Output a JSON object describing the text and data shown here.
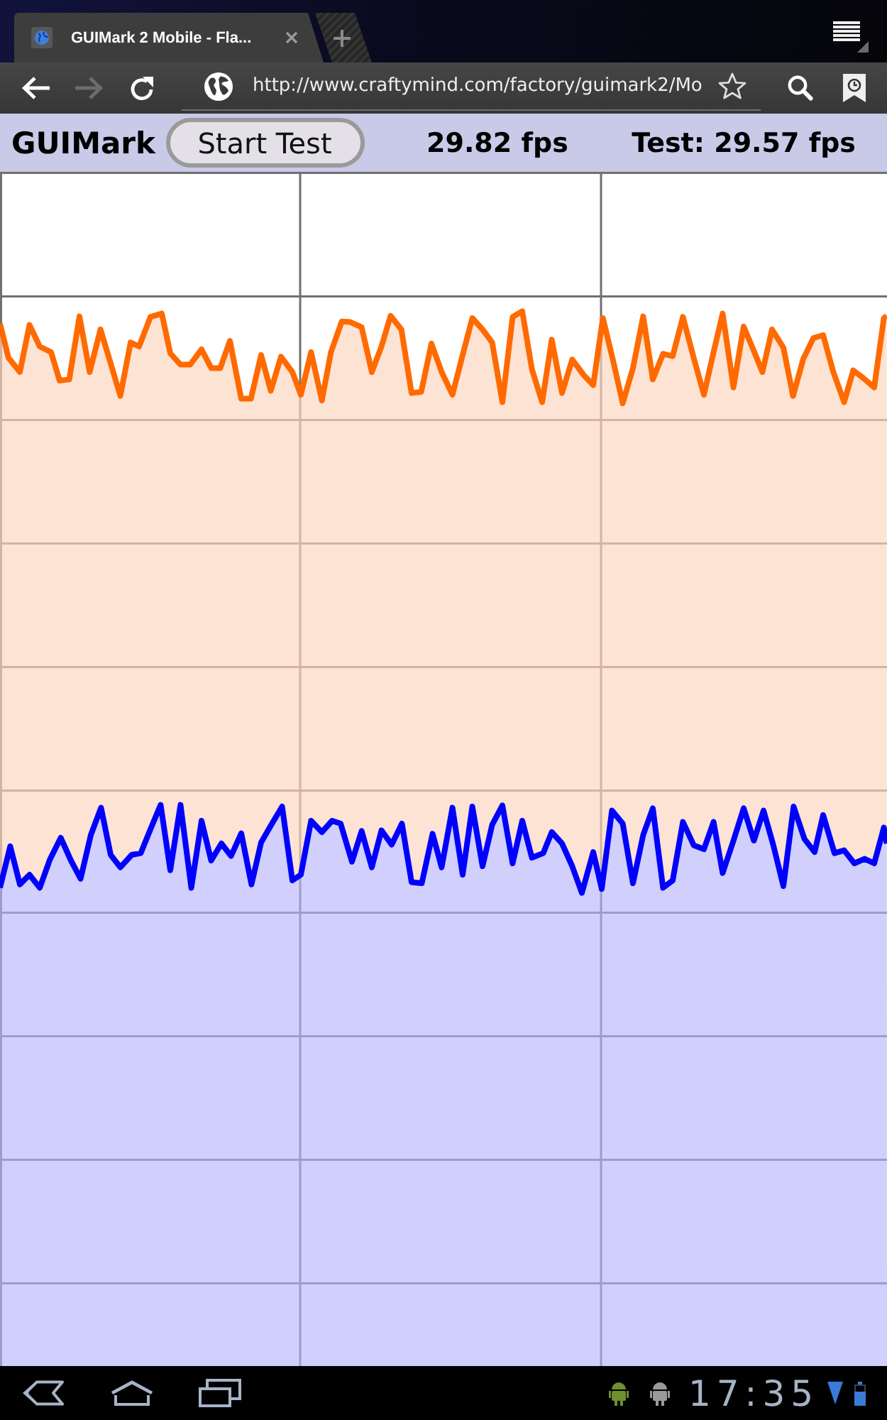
{
  "browser": {
    "tabs": [
      {
        "title": "GUIMark 2 Mobile - Fla...",
        "selected": true
      }
    ],
    "toolbar": {
      "nav_buttons": [
        {
          "kind": "back",
          "disabled": false
        },
        {
          "kind": "forward",
          "disabled": true
        },
        {
          "kind": "reload",
          "disabled": false
        }
      ],
      "url": "http://www.craftymind.com/factory/guimark2/Mo"
    }
  },
  "app": {
    "title": "GUIMark",
    "start_button": "Start Test",
    "fps": "29.82 fps",
    "test_fps": "Test: 29.57 fps"
  },
  "system_bar": {
    "time": "17:35"
  }
}
